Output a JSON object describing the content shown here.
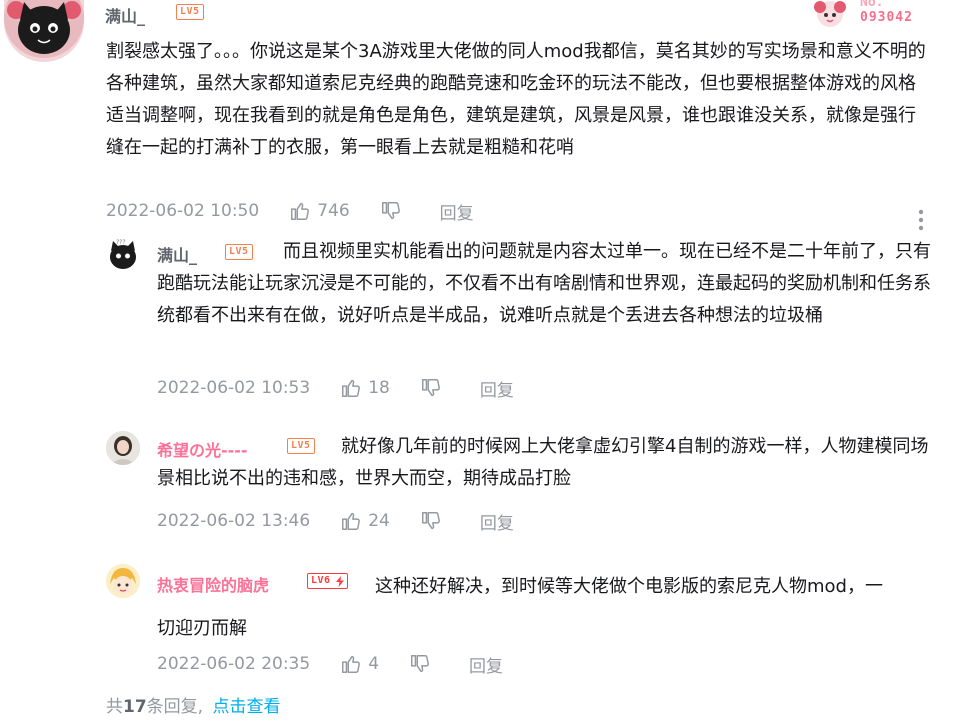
{
  "main_comment": {
    "username": "满山_",
    "level": "LV5",
    "text": "割裂感太强了。。。你说这是某个3A游戏里大佬做的同人mod我都信，莫名其妙的写实场景和意义不明的各种建筑，虽然大家都知道索尼克经典的跑酷竞速和吃金环的玩法不能改，但也要根据整体游戏的风格适当调整啊，现在我看到的就是角色是角色，建筑是建筑，风景是风景，谁也跟谁没关系，就像是强行缝在一起的打满补丁的衣服，第一眼看上去就是粗糙和花哨",
    "time": "2022-06-02 10:50",
    "likes": "746",
    "reply_label": "回复",
    "badge_no": "No.",
    "badge_number": "093042"
  },
  "replies": [
    {
      "username": "满山_",
      "level": "LV5",
      "text": "而且视频里实机能看出的问题就是内容太过单一。现在已经不是二十年前了，只有跑酷玩法能让玩家沉浸是不可能的，不仅看不出有啥剧情和世界观，连最起码的奖励机制和任务系统都看不出来有在做，说好听点是半成品，说难听点就是个丢进去各种想法的垃圾桶",
      "time": "2022-06-02 10:53",
      "likes": "18",
      "reply_label": "回复"
    },
    {
      "username": "希望の光----",
      "level": "LV5",
      "text": "就好像几年前的时候网上大佬拿虚幻引擎4自制的游戏一样，人物建模同场景相比说不出的违和感，世界大而空，期待成品打脸",
      "time": "2022-06-02 13:46",
      "likes": "24",
      "reply_label": "回复"
    },
    {
      "username": "热衷冒险的脑虎",
      "level": "LV6",
      "text": "这种还好解决，到时候等大佬做个电影版的索尼克人物mod，一切迎刃而解",
      "time": "2022-06-02 20:35",
      "likes": "4",
      "reply_label": "回复"
    }
  ],
  "footer": {
    "prefix": "共",
    "count": "17",
    "suffix": "条回复,",
    "link": "点击查看"
  },
  "colors": {
    "pink_name": "#fb7299",
    "link_blue": "#00aeec",
    "meta_gray": "#9499a0",
    "level_orange": "#f6804d",
    "level_red": "#ff3b3b"
  }
}
